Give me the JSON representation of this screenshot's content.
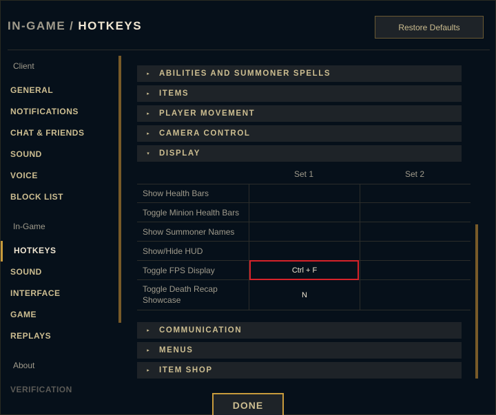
{
  "header": {
    "crumb": "IN-GAME",
    "separator": "/",
    "title": "HOTKEYS",
    "restore_label": "Restore Defaults"
  },
  "sidebar": {
    "client_group": "Client",
    "client_items": [
      "GENERAL",
      "NOTIFICATIONS",
      "CHAT & FRIENDS",
      "SOUND",
      "VOICE",
      "BLOCK LIST"
    ],
    "ingame_group": "In-Game",
    "ingame_items": [
      "HOTKEYS",
      "SOUND",
      "INTERFACE",
      "GAME",
      "REPLAYS"
    ],
    "about_group": "About",
    "about_items": [
      "VERIFICATION"
    ],
    "active_item": "HOTKEYS"
  },
  "sections_top": [
    {
      "label": "ABILITIES AND SUMMONER SPELLS",
      "caret": "▸"
    },
    {
      "label": "ITEMS",
      "caret": "▸"
    },
    {
      "label": "PLAYER MOVEMENT",
      "caret": "▸"
    },
    {
      "label": "CAMERA CONTROL",
      "caret": "▸"
    },
    {
      "label": "DISPLAY",
      "caret": "▾"
    }
  ],
  "display_table": {
    "columns": [
      "Set 1",
      "Set 2"
    ],
    "rows": [
      {
        "name": "Show Health Bars",
        "set1": "",
        "set2": ""
      },
      {
        "name": "Toggle Minion Health Bars",
        "set1": "",
        "set2": ""
      },
      {
        "name": "Show Summoner Names",
        "set1": "",
        "set2": ""
      },
      {
        "name": "Show/Hide HUD",
        "set1": "",
        "set2": ""
      },
      {
        "name": "Toggle FPS Display",
        "set1": "Ctrl + F",
        "set2": ""
      },
      {
        "name": "Toggle Death Recap Showcase",
        "set1": "N",
        "set2": ""
      }
    ]
  },
  "sections_bottom": [
    {
      "label": "COMMUNICATION",
      "caret": "▸"
    },
    {
      "label": "MENUS",
      "caret": "▸"
    },
    {
      "label": "ITEM SHOP",
      "caret": "▸"
    }
  ],
  "footer": {
    "done_label": "DONE"
  },
  "colors": {
    "gold": "#c89b3c",
    "text_gold": "#cdbe91",
    "highlight": "#d8232a",
    "background": "#010a13"
  }
}
